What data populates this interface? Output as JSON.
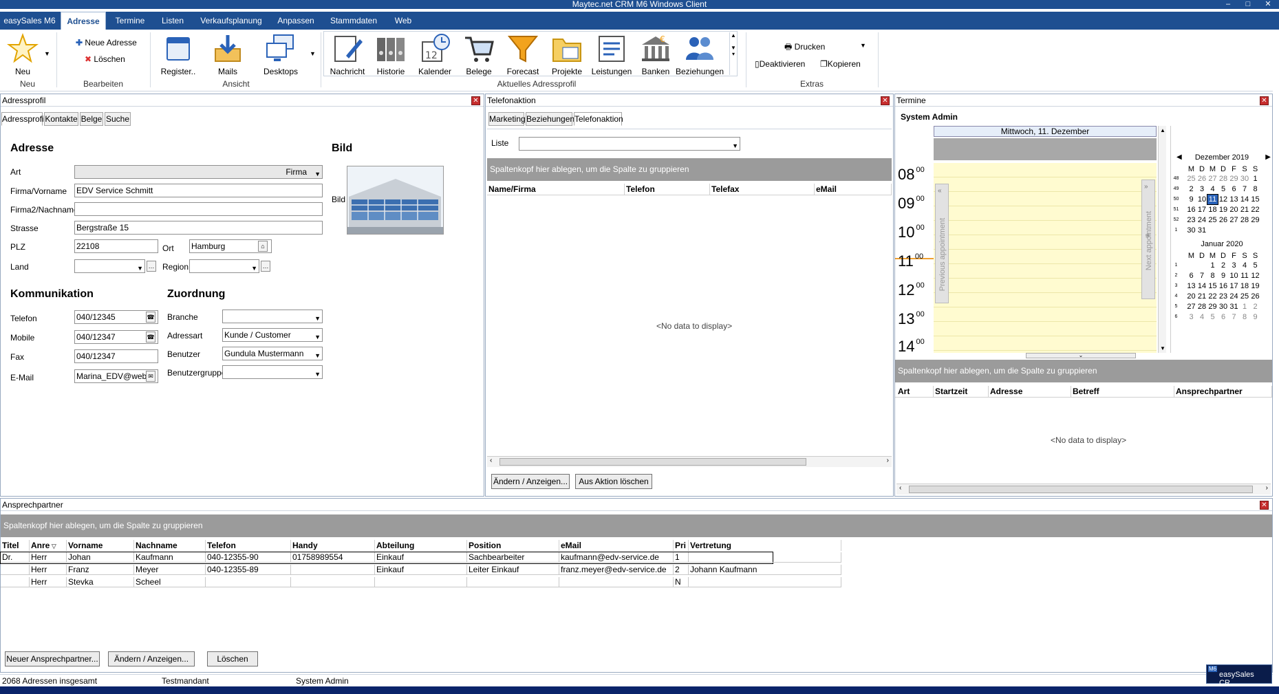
{
  "window": {
    "title": "Maytec.net CRM M6 Windows Client"
  },
  "menu": {
    "items": [
      "easySales M6",
      "Adresse",
      "Termine",
      "Listen",
      "Verkaufsplanung",
      "Anpassen",
      "Stammdaten",
      "Web"
    ]
  },
  "ribbon": {
    "neu": {
      "label": "Neu",
      "group": "Neu"
    },
    "neue_adresse": "Neue Adresse",
    "loeschen": "Löschen",
    "bearbeiten_group": "Bearbeiten",
    "register": "Register..",
    "mails": "Mails",
    "desktops": "Desktops",
    "ansicht_group": "Ansicht",
    "profile_buttons": [
      "Nachricht",
      "Historie",
      "Kalender",
      "Belege",
      "Forecast",
      "Projekte",
      "Leistungen",
      "Banken",
      "Beziehungen"
    ],
    "profile_group": "Aktuelles Adressprofil",
    "drucken": "Drucken",
    "deaktivieren": "Deaktivieren",
    "kopieren": "Kopieren",
    "extras_group": "Extras"
  },
  "adressprofil": {
    "title": "Adressprofil",
    "tabs": [
      "Adressprofil",
      "Kontakte",
      "Belge",
      "Suche"
    ],
    "sections": {
      "adresse": "Adresse",
      "bild": "Bild",
      "kommunikation": "Kommunikation",
      "zuordnung": "Zuordnung"
    },
    "fields": {
      "art": {
        "label": "Art",
        "value": "Firma"
      },
      "firma": {
        "label": "Firma/Vorname",
        "value": "EDV Service Schmitt"
      },
      "firma2": {
        "label": "Firma2/Nachname",
        "value": ""
      },
      "strasse": {
        "label": "Strasse",
        "value": "Bergstraße 15"
      },
      "plz": {
        "label": "PLZ",
        "value": "22108"
      },
      "ort": {
        "label": "Ort",
        "value": "Hamburg"
      },
      "land": {
        "label": "Land",
        "value": ""
      },
      "region": {
        "label": "Region",
        "value": ""
      },
      "bild": {
        "label": "Bild"
      },
      "telefon": {
        "label": "Telefon",
        "value": "040/12345"
      },
      "mobile": {
        "label": "Mobile",
        "value": "040/12347"
      },
      "fax": {
        "label": "Fax",
        "value": "040/12347"
      },
      "email": {
        "label": "E-Mail",
        "value": "Marina_EDV@web."
      },
      "branche": {
        "label": "Branche",
        "value": ""
      },
      "adressart": {
        "label": "Adressart",
        "value": "Kunde / Customer"
      },
      "benutzer": {
        "label": "Benutzer",
        "value": "Gundula Mustermann"
      },
      "benutzergruppe": {
        "label": "Benutzergruppe",
        "value": ""
      }
    }
  },
  "telefonaktion": {
    "title": "Telefonaktion",
    "tabs": [
      "Marketing",
      "Beziehungen",
      "Telefonaktion"
    ],
    "liste_label": "Liste",
    "group_hint": "Spaltenkopf hier ablegen, um die Spalte zu gruppieren",
    "columns": [
      "Name/Firma",
      "Telefon",
      "Telefax",
      "eMail"
    ],
    "nodata": "<No data to display>",
    "btn_aendern": "Ändern / Anzeigen...",
    "btn_loeschen": "Aus Aktion löschen"
  },
  "termine": {
    "title": "Termine",
    "user": "System Admin",
    "day_header": "Mittwoch, 11. Dezember",
    "hours": [
      "08",
      "09",
      "10",
      "11",
      "12",
      "13",
      "14"
    ],
    "minute": "00",
    "prev": "Previous appointment",
    "next": "Next appointment",
    "cal1": {
      "title": "Dezember 2019",
      "dow": [
        "M",
        "D",
        "M",
        "D",
        "F",
        "S",
        "S"
      ],
      "weeks": [
        [
          "48",
          "25",
          "26",
          "27",
          "28",
          "29",
          "30",
          "1"
        ],
        [
          "49",
          "2",
          "3",
          "4",
          "5",
          "6",
          "7",
          "8"
        ],
        [
          "50",
          "9",
          "10",
          "11",
          "12",
          "13",
          "14",
          "15"
        ],
        [
          "51",
          "16",
          "17",
          "18",
          "19",
          "20",
          "21",
          "22"
        ],
        [
          "52",
          "23",
          "24",
          "25",
          "26",
          "27",
          "28",
          "29"
        ],
        [
          "1",
          "30",
          "31",
          "",
          "",
          "",
          "",
          ""
        ]
      ]
    },
    "cal2": {
      "title": "Januar 2020",
      "dow": [
        "M",
        "D",
        "M",
        "D",
        "F",
        "S",
        "S"
      ],
      "weeks": [
        [
          "1",
          "",
          "",
          "1",
          "2",
          "3",
          "4",
          "5"
        ],
        [
          "2",
          "6",
          "7",
          "8",
          "9",
          "10",
          "11",
          "12"
        ],
        [
          "3",
          "13",
          "14",
          "15",
          "16",
          "17",
          "18",
          "19"
        ],
        [
          "4",
          "20",
          "21",
          "22",
          "23",
          "24",
          "25",
          "26"
        ],
        [
          "5",
          "27",
          "28",
          "29",
          "30",
          "31",
          "1",
          "2"
        ],
        [
          "6",
          "3",
          "4",
          "5",
          "6",
          "7",
          "8",
          "9"
        ]
      ]
    },
    "group_hint": "Spaltenkopf hier ablegen, um die Spalte zu gruppieren",
    "columns": [
      "Art",
      "Startzeit",
      "Adresse",
      "Betreff",
      "Ansprechpartner"
    ],
    "nodata": "<No data to display>"
  },
  "ansprechpartner": {
    "title": "Ansprechpartner",
    "group_hint": "Spaltenkopf hier ablegen, um die Spalte zu gruppieren",
    "columns": [
      "Titel",
      "Anre",
      "Vorname",
      "Nachname",
      "Telefon",
      "Handy",
      "Abteilung",
      "Position",
      "eMail",
      "Pri",
      "Vertretung"
    ],
    "rows": [
      [
        "Dr.",
        "Herr",
        "Johan",
        "Kaufmann",
        "040-12355-90",
        "01758989554",
        "Einkauf",
        "Sachbearbeiter",
        "kaufmann@edv-service.de",
        "1",
        ""
      ],
      [
        "",
        "Herr",
        "Franz",
        "Meyer",
        "040-12355-89",
        "",
        "Einkauf",
        "Leiter Einkauf",
        "franz.meyer@edv-service.de",
        "2",
        "Johann Kaufmann"
      ],
      [
        "",
        "Herr",
        "Stevka",
        "Scheel",
        "",
        "",
        "",
        "",
        "",
        "N",
        ""
      ]
    ],
    "btn_neu": "Neuer Ansprechpartner...",
    "btn_aendern": "Ändern / Anzeigen...",
    "btn_loeschen": "Löschen"
  },
  "status": {
    "count": "2068 Adressen insgesamt",
    "mandant": "Testmandant",
    "user": "System Admin"
  },
  "taskbar": {
    "badge": "M6",
    "label": "easySales CR..."
  },
  "colors": {
    "titlebar": "#1e4f91",
    "yellow": "#fffbd0",
    "group": "#9b9b9b",
    "accent": "#1e6fb8"
  }
}
